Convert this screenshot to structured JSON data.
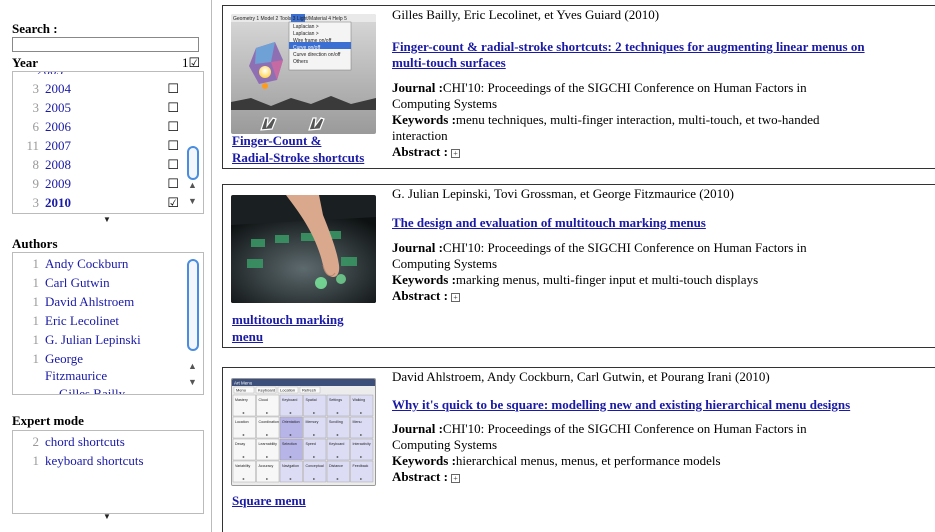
{
  "sidebar": {
    "search_label": "Search :",
    "search_value": "",
    "year_label": "Year",
    "year_count": "1",
    "years": [
      {
        "count": "3",
        "label": "2004",
        "checked": false
      },
      {
        "count": "3",
        "label": "2005",
        "checked": false
      },
      {
        "count": "6",
        "label": "2006",
        "checked": false
      },
      {
        "count": "11",
        "label": "2007",
        "checked": false
      },
      {
        "count": "8",
        "label": "2008",
        "checked": false
      },
      {
        "count": "9",
        "label": "2009",
        "checked": false
      },
      {
        "count": "3",
        "label": "2010",
        "checked": true
      }
    ],
    "authors_label": "Authors",
    "authors": [
      {
        "count": "1",
        "label": "Andy Cockburn"
      },
      {
        "count": "1",
        "label": "Carl Gutwin"
      },
      {
        "count": "1",
        "label": "David Ahlstroem"
      },
      {
        "count": "1",
        "label": "Eric Lecolinet"
      },
      {
        "count": "1",
        "label": "G. Julian Lepinski"
      },
      {
        "count": "1",
        "label": "George"
      },
      {
        "count": "",
        "label": "Fitzmaurice"
      }
    ],
    "expert_label": "Expert mode",
    "expert": [
      {
        "count": "2",
        "label": "chord shortcuts"
      },
      {
        "count": "1",
        "label": "keyboard shortcuts"
      }
    ]
  },
  "papers": [
    {
      "authors": "Gilles Bailly, Eric Lecolinet, et Yves Guiard (2010)",
      "title_l1": "Finger-count & radial-stroke shortcuts: 2 techniques for augmenting linear menus on",
      "title_l2": "multi-touch surfaces",
      "journal_label": "Journal :",
      "journal_l1": "CHI'10: Proceedings of the SIGCHI Conference on Human Factors in",
      "journal_l2": "Computing Systems",
      "keywords_label": "Keywords :",
      "keywords_l1": "menu techniques, multi-finger interaction, multi-touch, et two-handed",
      "keywords_l2": "interaction",
      "abstract_label": "Abstract :",
      "thumb_l1": "Finger-Count &",
      "thumb_l2": "Radial-Stroke shortcuts"
    },
    {
      "authors": "G. Julian Lepinski, Tovi Grossman, et George Fitzmaurice (2010)",
      "title_l1": "The design and evaluation of multitouch marking menus",
      "journal_label": "Journal :",
      "journal_l1": "CHI'10: Proceedings of the SIGCHI Conference on Human Factors in",
      "journal_l2": "Computing Systems",
      "keywords_label": "Keywords :",
      "keywords_l1": "marking menus, multi-finger input et multi-touch displays",
      "abstract_label": "Abstract :",
      "thumb_l1": "multitouch marking",
      "thumb_l2": "menu"
    },
    {
      "authors": "David Ahlstroem, Andy Cockburn, Carl Gutwin, et Pourang Irani (2010)",
      "title_l1": "Why it's quick to be square: modelling new and existing hierarchical menu designs",
      "journal_label": "Journal :",
      "journal_l1": "CHI'10: Proceedings of the SIGCHI Conference on Human Factors in",
      "journal_l2": "Computing Systems",
      "keywords_label": "Keywords :",
      "keywords_l1": "hierarchical menus, menus, et performance models",
      "abstract_label": "Abstract :",
      "thumb_l1": "Square menu"
    }
  ],
  "thumb1_menu": {
    "menubar": "Geometry 1  Model 2  Tools 3  Light/Material 4  Help 5",
    "items": [
      "Laplacian >",
      "Laplacian >",
      "Wire frame on/off",
      "Curve on/off",
      "Curve direction on/off",
      "Others"
    ]
  },
  "thumb3": {
    "title": "Art Menu",
    "tabs": [
      "Menu",
      "Keyboard",
      "Location",
      "Refresh"
    ],
    "cells": [
      "Mastery",
      "Cloud",
      "Keyboard",
      "Spatial",
      "Settings",
      "Walking",
      "Location",
      "Coordination",
      "Orientation",
      "Memory",
      "Scrolling",
      "Menu",
      "Decay",
      "Learnability",
      "Selection",
      "Speed",
      "Keyboard",
      "Interactivity",
      "Variability",
      "Accuracy",
      "Navigation",
      "Conceptual",
      "Distance",
      "Feedback"
    ]
  },
  "colors": {
    "link": "#1a1aa6",
    "scroll": "#4a8de0"
  }
}
